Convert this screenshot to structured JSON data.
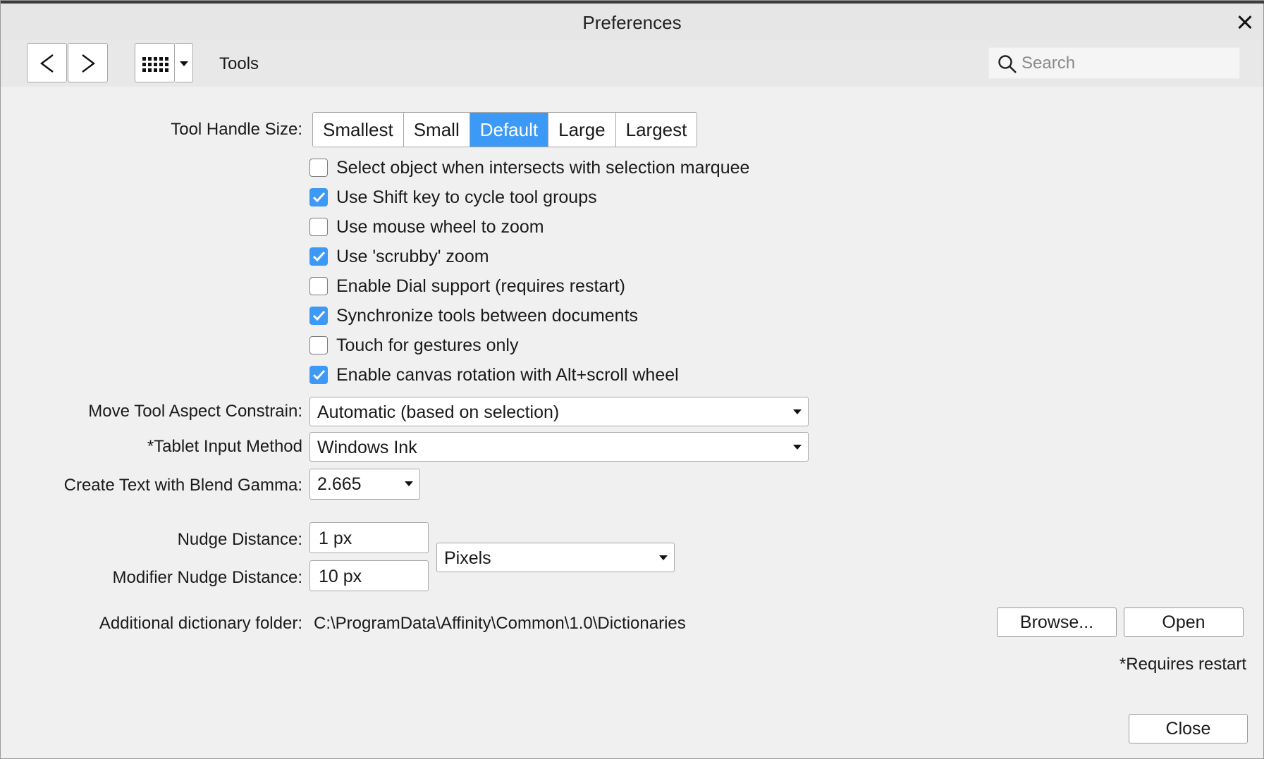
{
  "window": {
    "title": "Preferences"
  },
  "toolbar": {
    "section_title": "Tools",
    "search_placeholder": "Search"
  },
  "handle_size": {
    "label": "Tool Handle Size:",
    "options": [
      "Smallest",
      "Small",
      "Default",
      "Large",
      "Largest"
    ],
    "selected": "Default"
  },
  "checkboxes": [
    {
      "label": "Select object when intersects with selection marquee",
      "checked": false
    },
    {
      "label": "Use Shift key to cycle tool groups",
      "checked": true
    },
    {
      "label": "Use mouse wheel to zoom",
      "checked": false
    },
    {
      "label": "Use 'scrubby' zoom",
      "checked": true
    },
    {
      "label": "Enable Dial support (requires restart)",
      "checked": false
    },
    {
      "label": "Synchronize tools between documents",
      "checked": true
    },
    {
      "label": "Touch for gestures only",
      "checked": false
    },
    {
      "label": "Enable canvas rotation with Alt+scroll wheel",
      "checked": true
    }
  ],
  "move_tool": {
    "label": "Move Tool Aspect Constrain:",
    "value": "Automatic (based on selection)"
  },
  "tablet": {
    "label": "*Tablet Input Method",
    "value": "Windows Ink"
  },
  "blend_gamma": {
    "label": "Create Text with Blend Gamma:",
    "value": "2.665"
  },
  "nudge": {
    "label": "Nudge Distance:",
    "value": "1 px",
    "modifier_label": "Modifier Nudge Distance:",
    "modifier_value": "10 px",
    "unit": "Pixels"
  },
  "dictionary": {
    "label": "Additional dictionary folder:",
    "path": "C:\\ProgramData\\Affinity\\Common\\1.0\\Dictionaries",
    "browse_label": "Browse...",
    "open_label": "Open"
  },
  "footer": {
    "note": "*Requires restart",
    "close_label": "Close"
  },
  "colors": {
    "accent": "#3c99f5",
    "background": "#f0f0f0"
  }
}
